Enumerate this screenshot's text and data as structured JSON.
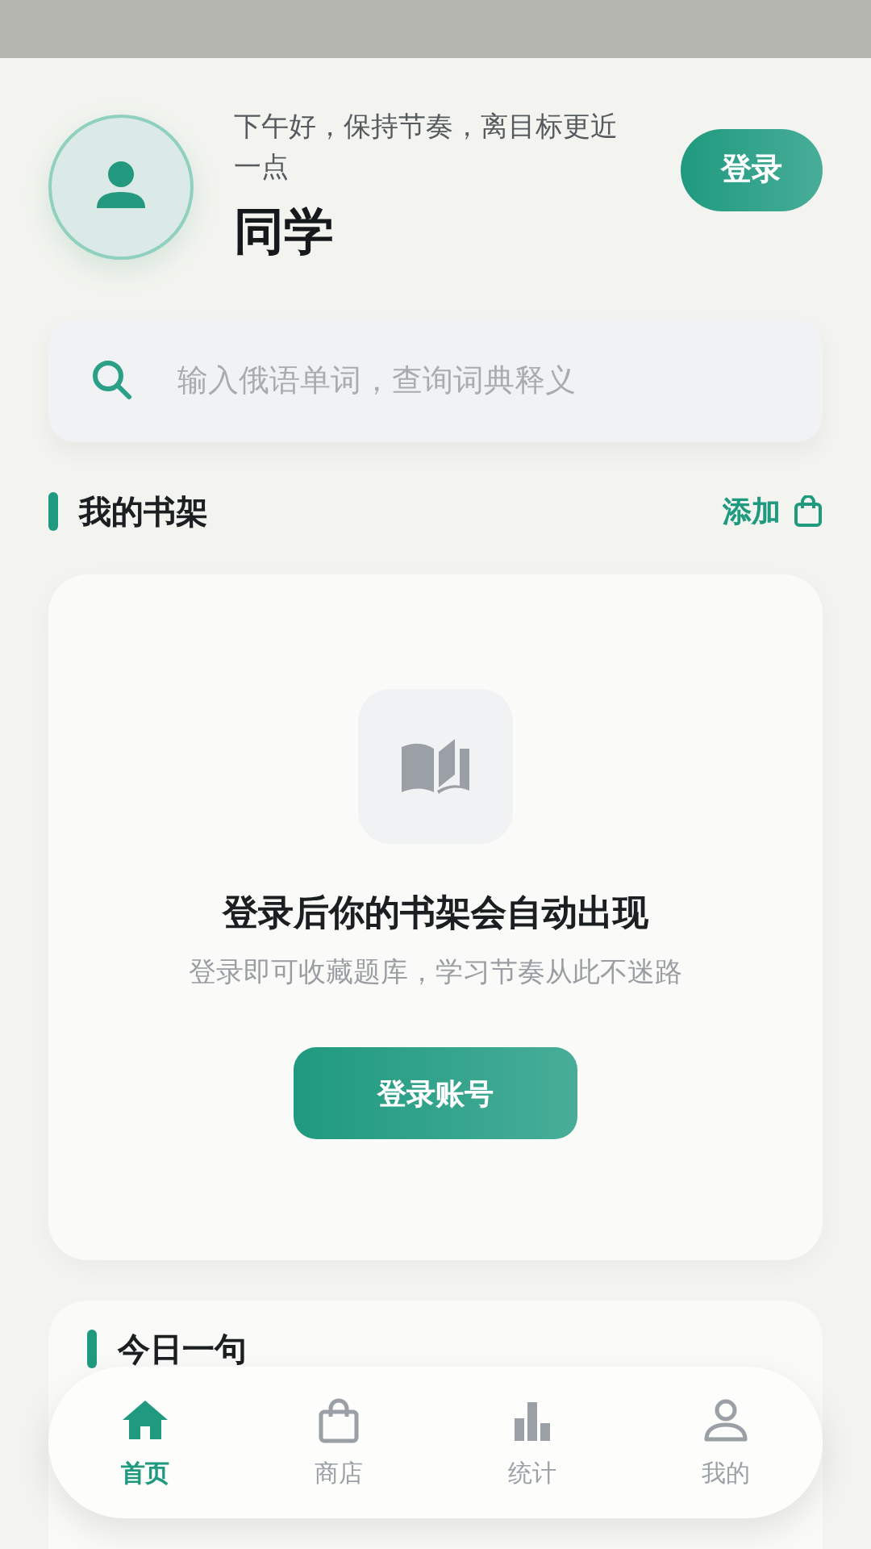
{
  "header": {
    "greeting": "下午好，保持节奏，离目标更近一点",
    "name": "同学",
    "login_button": "登录"
  },
  "search": {
    "placeholder": "输入俄语单词，查询词典释义"
  },
  "bookshelf": {
    "title": "我的书架",
    "add_link": "添加",
    "empty_title": "登录后你的书架会自动出现",
    "empty_subtitle": "登录即可收藏题库，学习节奏从此不迷路",
    "button": "登录账号"
  },
  "daily": {
    "title": "今日一句"
  },
  "nav": [
    {
      "label": "首页",
      "kind": "home",
      "selected": true
    },
    {
      "label": "商店",
      "kind": "shop",
      "selected": false
    },
    {
      "label": "统计",
      "kind": "stats",
      "selected": false
    },
    {
      "label": "我的",
      "kind": "profile",
      "selected": false
    }
  ]
}
